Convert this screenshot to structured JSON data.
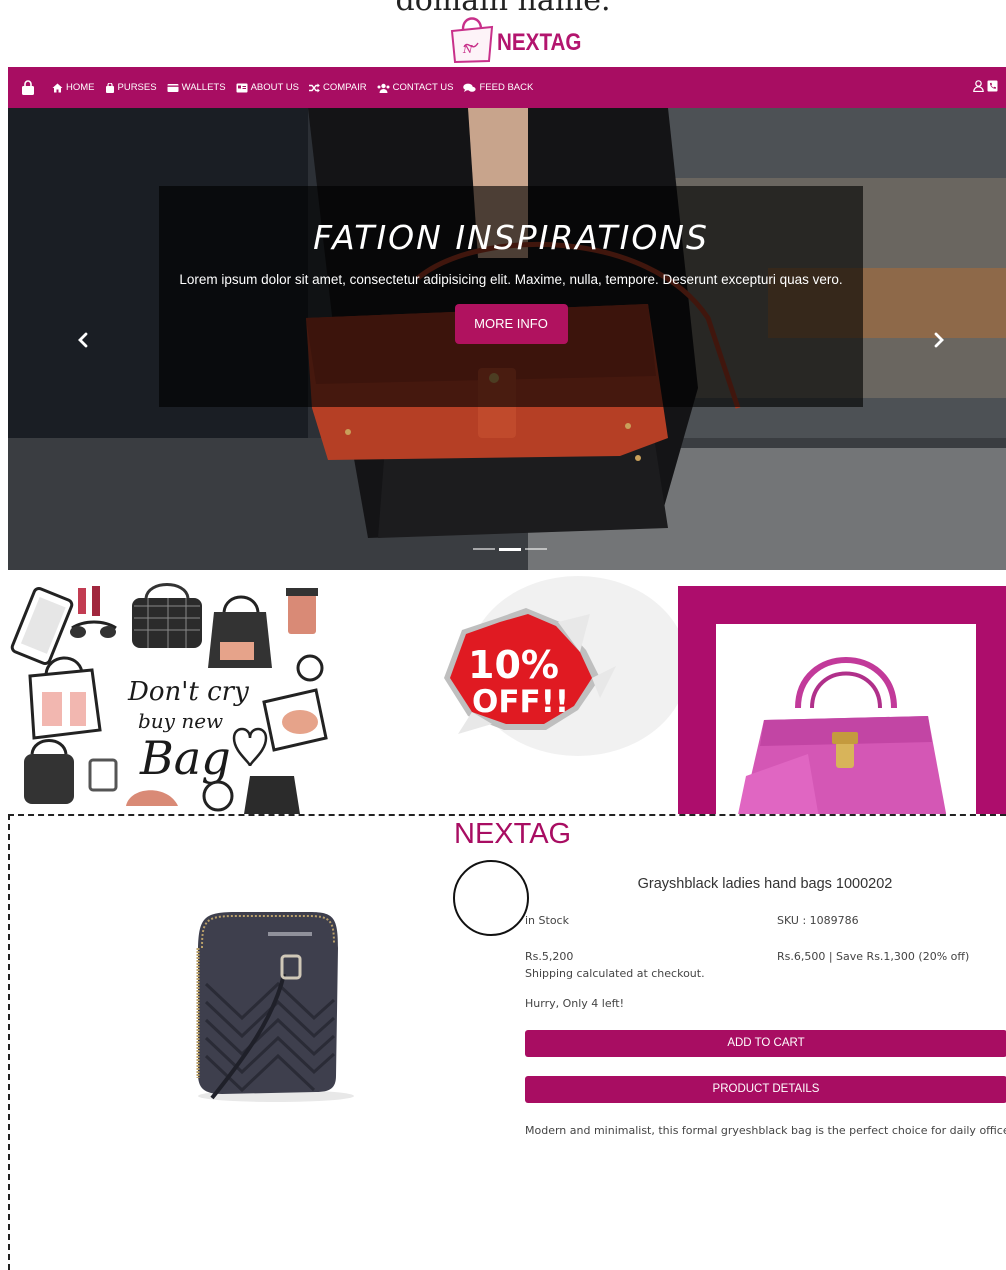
{
  "caption": "domain name.",
  "logo": {
    "text": "NEXTAG"
  },
  "nav": {
    "items": [
      {
        "label": "HOME",
        "icon": "home-icon"
      },
      {
        "label": "PURSES",
        "icon": "bag-icon"
      },
      {
        "label": "WALLETS",
        "icon": "wallet-icon"
      },
      {
        "label": "ABOUT US",
        "icon": "id-card-icon"
      },
      {
        "label": "COMPAIR",
        "icon": "shuffle-icon"
      },
      {
        "label": "CONTACT US",
        "icon": "users-icon"
      },
      {
        "label": "FEED BACK",
        "icon": "comments-icon"
      }
    ]
  },
  "hero": {
    "title": "FATION INSPIRATIONS",
    "text": "Lorem ipsum dolor sit amet, consectetur adipisicing elit. Maxime, nulla, tempore. Deserunt excepturi quas vero.",
    "button": "MORE INFO",
    "slides": 3,
    "active_slide": 2
  },
  "promo": {
    "discount": "10% OFF!!",
    "sketch_text": "Don't cry buy new Bag"
  },
  "product": {
    "brand": "NEXTAG",
    "title": "Grayshblack ladies hand bags 1000202",
    "stock": "in Stock",
    "sku": "SKU : 1089786",
    "price": "Rs.5,200",
    "original_price": "Rs.6,500 | Save Rs.1,300 (20% off)",
    "shipping": "Shipping calculated at checkout.",
    "urgency": "Hurry, Only 4 left!",
    "add_to_cart": "ADD TO CART",
    "details_button": "PRODUCT DETAILS",
    "description": "Modern and minimalist, this formal gryeshblack bag is the perfect choice for daily office use."
  },
  "colors": {
    "brand": "#a80d62",
    "accent": "#b0125f"
  }
}
